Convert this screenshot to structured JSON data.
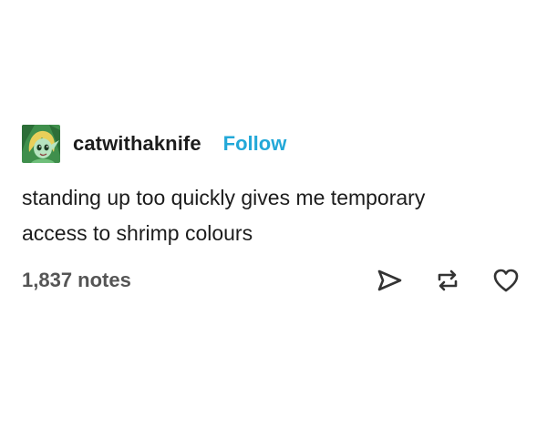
{
  "post": {
    "author": {
      "username": "catwithaknife",
      "avatar_icon": "elf-avatar-icon"
    },
    "follow_label": "Follow",
    "body_lines": [
      "standing up too quickly gives me temporary",
      "access to shrimp colours"
    ],
    "notes": "1,837 notes",
    "actions": {
      "share_icon": "paper-plane-icon",
      "reblog_icon": "reblog-icon",
      "like_icon": "heart-icon"
    }
  },
  "colors": {
    "follow": "#23a8d8",
    "text": "#1c1c1c",
    "notes": "#555555",
    "icons": "#333333"
  }
}
